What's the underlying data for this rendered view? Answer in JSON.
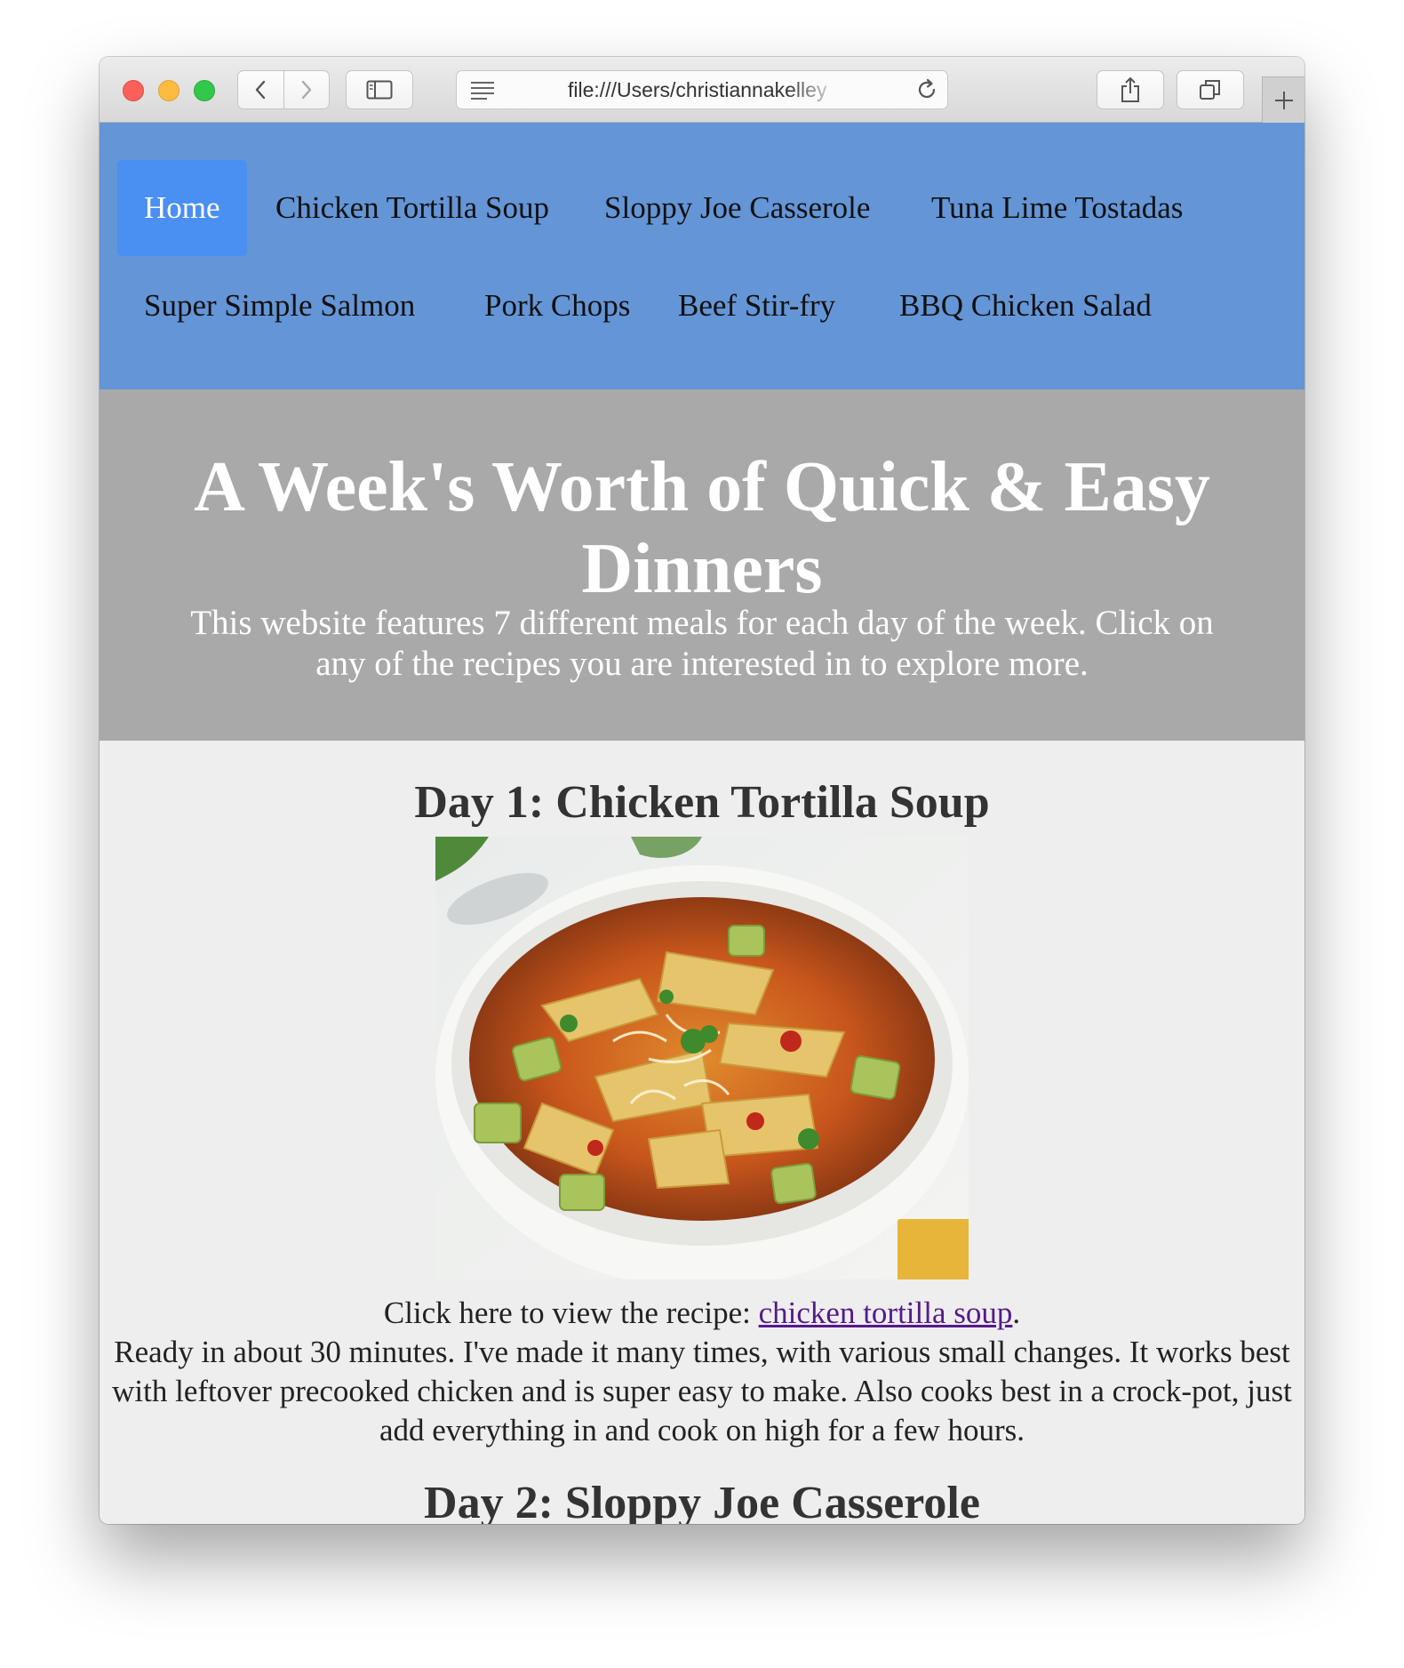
{
  "browser": {
    "url": "file:///Users/christiannakelley"
  },
  "nav": {
    "items": [
      {
        "label": "Home",
        "active": true
      },
      {
        "label": "Chicken Tortilla Soup",
        "active": false
      },
      {
        "label": "Sloppy Joe Casserole",
        "active": false
      },
      {
        "label": "Tuna Lime Tostadas",
        "active": false
      },
      {
        "label": "Super Simple Salmon",
        "active": false
      },
      {
        "label": "Pork Chops",
        "active": false
      },
      {
        "label": "Beef Stir-fry",
        "active": false
      },
      {
        "label": "BBQ Chicken Salad",
        "active": false
      }
    ]
  },
  "hero": {
    "title": "A Week's Worth of Quick & Easy Dinners",
    "subtitle": "This website features 7 different meals for each day of the week. Click on any of the recipes you are interested in to explore more."
  },
  "days": [
    {
      "heading": "Day 1: Chicken Tortilla Soup",
      "recipe_prefix": "Click here to view the recipe: ",
      "recipe_link": "chicken tortilla soup",
      "recipe_suffix": ".",
      "description": "Ready in about 30 minutes. I've made it many times, with various small changes. It works best with leftover precooked chicken and is super easy to make. Also cooks best in a crock-pot, just add everything in and cook on high for a few hours."
    },
    {
      "heading": "Day 2: Sloppy Joe Casserole"
    }
  ],
  "colors": {
    "navbar": "#6495d6",
    "nav_active": "#4a8ff2",
    "hero": "#a9a9a9",
    "content": "#eeeeee",
    "link": "#551a8b"
  }
}
